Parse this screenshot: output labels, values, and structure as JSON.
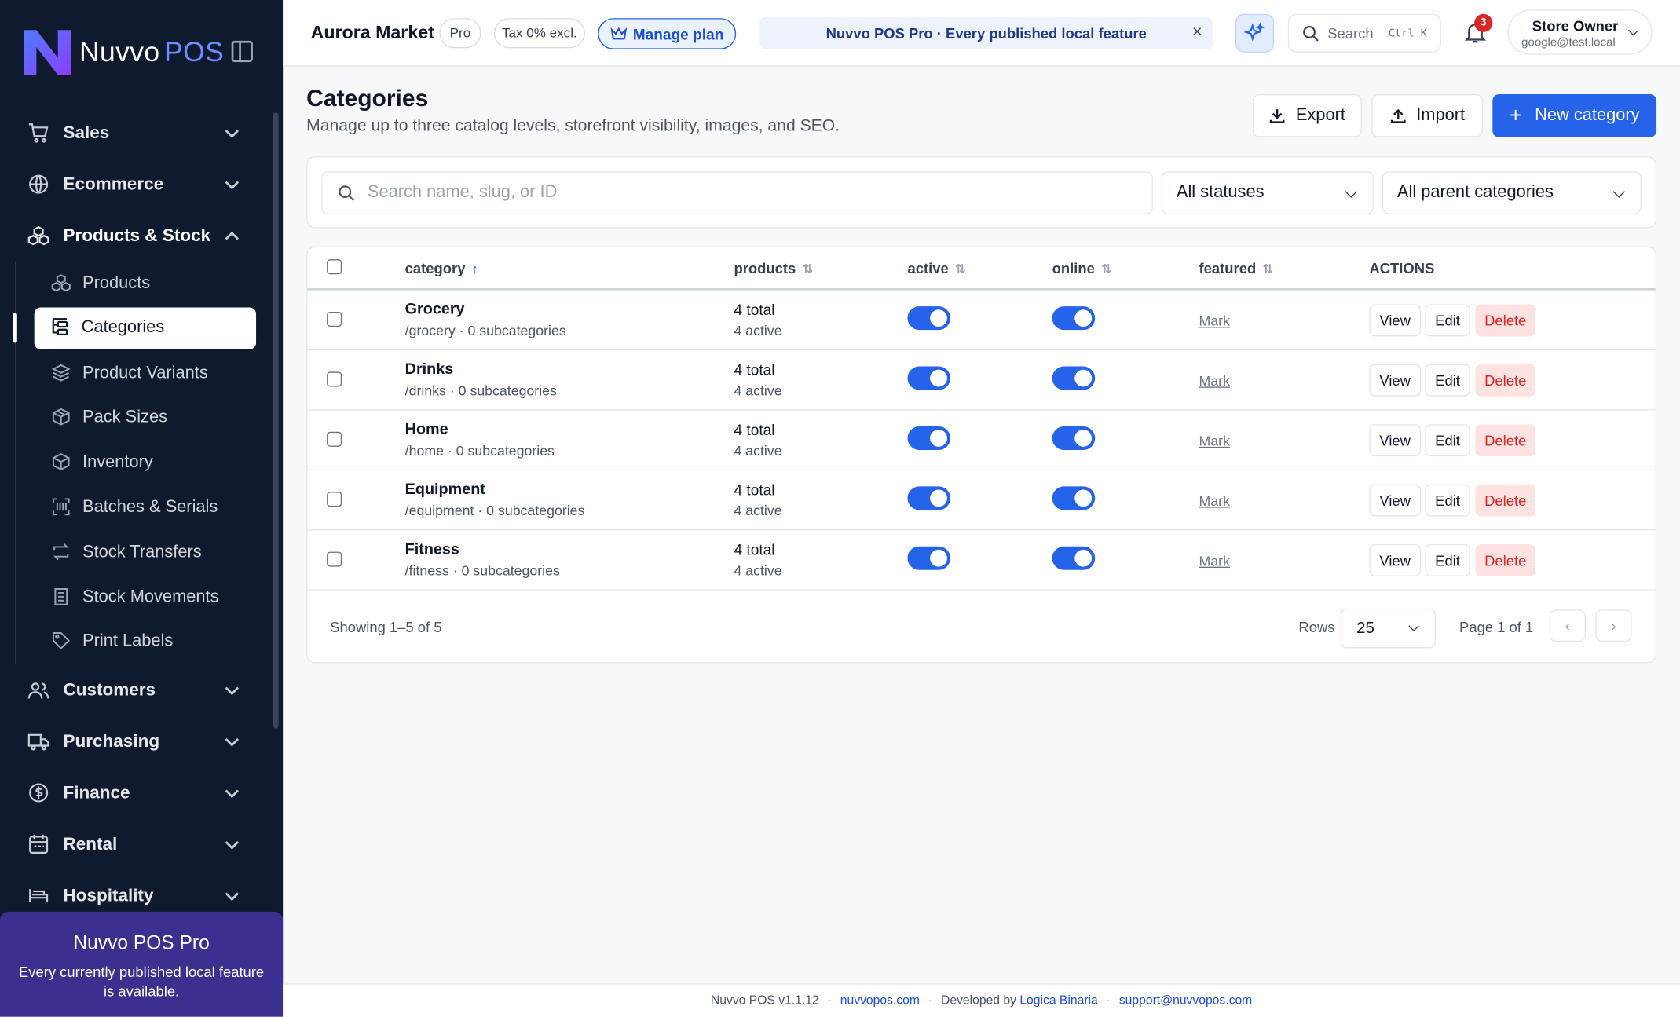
{
  "brand": {
    "name": "Nuvvo",
    "suffix": "POS"
  },
  "sidebar": {
    "groups_top": [
      {
        "label": "Sales",
        "icon": "cart-icon"
      },
      {
        "label": "Ecommerce",
        "icon": "globe-icon"
      }
    ],
    "products_group": {
      "label": "Products & Stock",
      "icon": "cubes-icon"
    },
    "sub_items": [
      {
        "label": "Products",
        "icon": "cubes-icon"
      },
      {
        "label": "Categories",
        "icon": "category-tree-icon",
        "active": true
      },
      {
        "label": "Product Variants",
        "icon": "layers-icon"
      },
      {
        "label": "Pack Sizes",
        "icon": "package-icon"
      },
      {
        "label": "Inventory",
        "icon": "box-icon"
      },
      {
        "label": "Batches & Serials",
        "icon": "barcode-icon"
      },
      {
        "label": "Stock Transfers",
        "icon": "transfer-icon"
      },
      {
        "label": "Stock Movements",
        "icon": "ledger-icon"
      },
      {
        "label": "Print Labels",
        "icon": "tag-icon"
      }
    ],
    "groups_bottom": [
      {
        "label": "Customers",
        "icon": "users-icon"
      },
      {
        "label": "Purchasing",
        "icon": "truck-icon"
      },
      {
        "label": "Finance",
        "icon": "dollar-icon"
      },
      {
        "label": "Rental",
        "icon": "calendar-icon"
      },
      {
        "label": "Hospitality",
        "icon": "bed-icon"
      }
    ],
    "promo": {
      "title": "Nuvvo POS Pro",
      "text": "Every currently published local feature is available."
    }
  },
  "topbar": {
    "store_name": "Aurora Market",
    "plan_pill": "Pro",
    "tax_pill": "Tax 0% excl.",
    "manage_plan": "Manage plan",
    "banner": "Nuvvo POS Pro · Every published local feature",
    "banner_close": "×",
    "search_label": "Search",
    "search_kbd": "Ctrl K",
    "notification_count": "3",
    "user_name": "Store Owner",
    "user_email": "google@test.local"
  },
  "page": {
    "title": "Categories",
    "subtitle": "Manage up to three catalog levels, storefront visibility, images, and SEO.",
    "export": "Export",
    "import": "Import",
    "new_category": "New category"
  },
  "filters": {
    "search_placeholder": "Search name, slug, or ID",
    "status": "All statuses",
    "parent": "All parent categories"
  },
  "table": {
    "columns": {
      "category": "category",
      "products": "products",
      "active": "active",
      "online": "online",
      "featured": "featured",
      "actions": "ACTIONS"
    },
    "rows": [
      {
        "name": "Grocery",
        "meta": "/grocery · 0 subcategories",
        "total": "4 total",
        "active_count": "4 active",
        "active": true,
        "online": true,
        "featured": "Mark"
      },
      {
        "name": "Drinks",
        "meta": "/drinks · 0 subcategories",
        "total": "4 total",
        "active_count": "4 active",
        "active": true,
        "online": true,
        "featured": "Mark"
      },
      {
        "name": "Home",
        "meta": "/home · 0 subcategories",
        "total": "4 total",
        "active_count": "4 active",
        "active": true,
        "online": true,
        "featured": "Mark"
      },
      {
        "name": "Equipment",
        "meta": "/equipment · 0 subcategories",
        "total": "4 total",
        "active_count": "4 active",
        "active": true,
        "online": true,
        "featured": "Mark"
      },
      {
        "name": "Fitness",
        "meta": "/fitness · 0 subcategories",
        "total": "4 total",
        "active_count": "4 active",
        "active": true,
        "online": true,
        "featured": "Mark"
      }
    ],
    "actions": {
      "view": "View",
      "edit": "Edit",
      "delete": "Delete"
    },
    "showing": "Showing 1–5 of 5",
    "rows_label": "Rows",
    "rows_value": "25",
    "page_label": "Page 1 of 1"
  },
  "footer": {
    "version": "Nuvvo POS v1.1.12",
    "site": "nuvvopos.com",
    "developed_by": "Developed by",
    "developer": "Logica Binaria",
    "support": "support@nuvvopos.com"
  },
  "colors": {
    "sidebar_bg": "#0f1a2e",
    "accent": "#2563eb",
    "promo_bg": "#3b2f8f",
    "danger": "#dc2626"
  }
}
